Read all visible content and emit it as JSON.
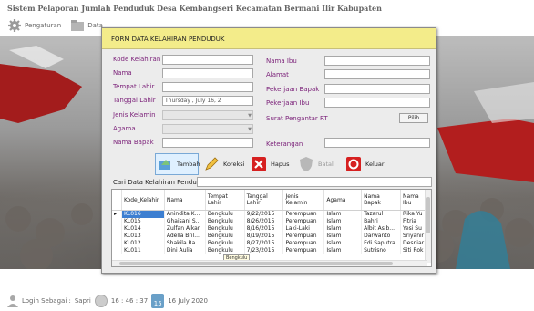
{
  "app": {
    "title": "Sistem Pelaporan Jumlah Penduduk Desa Kembangseri Kecamatan Bermani Ilir Kabupaten",
    "menu": [
      {
        "label": "Pengaturan",
        "icon": "gear-icon"
      },
      {
        "label": "Data",
        "icon": "folder-icon"
      }
    ]
  },
  "status": {
    "login_label": "Login Sebagai :",
    "user": "Sapri",
    "time": "16 : 46 : 37",
    "calendar_day": "15",
    "date": "16 July 2020"
  },
  "form": {
    "title": "FORM DATA KELAHIRAN PENDUDUK",
    "labels": {
      "kode": "Kode Kelahiran",
      "nama": "Nama",
      "tempat_lahir": "Tempat Lahir",
      "tanggal_lahir": "Tanggal Lahir",
      "jenis_kelamin": "Jenis Kelamin",
      "agama": "Agama",
      "nama_bapak": "Nama Bapak",
      "nama_ibu": "Nama Ibu",
      "alamat": "Alamat",
      "pekerjaan_bapak": "Pekerjaan Bapak",
      "pekerjaan_ibu": "Pekerjaan Ibu",
      "surat_pengantar": "Surat Pengantar RT",
      "keterangan": "Keterangan"
    },
    "tanggal_value": "Thursday ,    July    16, 2",
    "pilih_label": "Pilih",
    "buttons": {
      "tambah": "Tambah",
      "koreksi": "Koreksi",
      "hapus": "Hapus",
      "batal": "Batal",
      "keluar": "Keluar"
    },
    "search_label": "Cari Data Kelahiran Penduduk",
    "tooltip": "Bengkulu"
  },
  "table": {
    "columns": [
      "Kode_Kelahir",
      "Nama",
      "Tempat Lahir",
      "Tanggal Lahir",
      "Jenis Kelamin",
      "Agama",
      "Nama Bapak",
      "Nama Ibu"
    ],
    "rows": [
      [
        "KL016",
        "Anindita K...",
        "Bengkulu",
        "9/22/2015",
        "Perempuan",
        "Islam",
        "Tazarul",
        "Rika Yu"
      ],
      [
        "KL015",
        "Ghaisani S...",
        "Bengkulu",
        "8/26/2015",
        "Perempuan",
        "Islam",
        "Bahri",
        "Fitria"
      ],
      [
        "KL014",
        "Zulfan Alkar",
        "Bengkulu",
        "8/16/2015",
        "Laki-Laki",
        "Islam",
        "Albit Asib...",
        "Yesi Su"
      ],
      [
        "KL013",
        "Adella Bril...",
        "Bengkulu",
        "8/19/2015",
        "Perempuan",
        "Islam",
        "Darwanto",
        "Sriyanir"
      ],
      [
        "KL012",
        "Shakila Ra...",
        "Bengkulu",
        "8/27/2015",
        "Perempuan",
        "Islam",
        "Edi Saputra",
        "Desniar"
      ],
      [
        "KL011",
        "Dini Aulia",
        "Bengkulu",
        "7/23/2015",
        "Perempuan",
        "Islam",
        "Sutrisno",
        "Siti Rok"
      ]
    ]
  }
}
